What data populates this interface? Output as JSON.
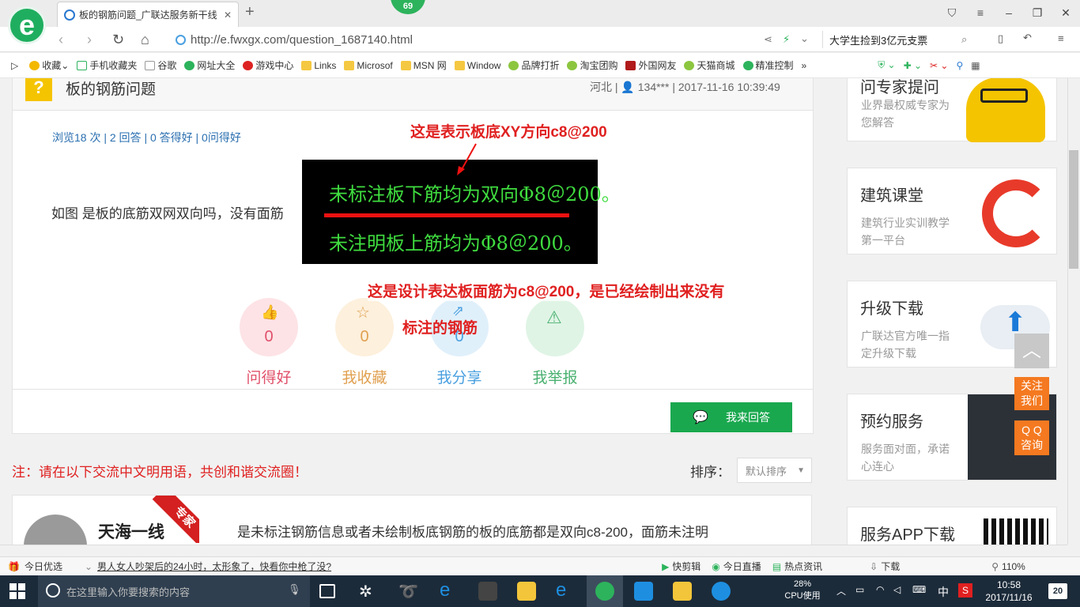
{
  "browser": {
    "tab_title": "板的钢筋问题_广联达服务新干线",
    "tab_close": "✕",
    "new_tab": "+",
    "badge": "69",
    "url": "http://e.fwxgx.com/question_1687140.html",
    "search_text": "大学生捡到3亿元支票",
    "bookmarks": [
      "收藏",
      "手机收藏夹",
      "谷歌",
      "网址大全",
      "游戏中心",
      "Links",
      "Microsof",
      "MSN 网",
      "Window",
      "品牌打折",
      "淘宝团购",
      "外国网友",
      "天猫商城",
      "精准控制"
    ]
  },
  "question": {
    "title": "板的钢筋问题",
    "location": "河北",
    "user": "134***",
    "time": "2017-11-16 10:39:49",
    "stats": "浏览18 次 | 2 回答 | 0 答得好 | 0问得好",
    "body": "如图  是板的底筋双网双向吗，没有面筋",
    "annotation1": "这是表示板底XY方向c8@200",
    "annotation2_line1": "这是设计表达板面筋为c8@200，是已经绘制出来没有",
    "annotation2_line2": "标注的钢筋",
    "cad_line1": "未标注板下筋均为双向Φ8＠200。",
    "cad_line2": "未注明板上筋均为Φ8＠200。"
  },
  "actions": [
    {
      "count": "0",
      "label": "问得好",
      "color": "#e0506a"
    },
    {
      "count": "0",
      "label": "我收藏",
      "color": "#e0a050"
    },
    {
      "count": "0",
      "label": "我分享",
      "color": "#4aa0e0"
    },
    {
      "count": "",
      "label": "我举报",
      "color": "#4ab070"
    }
  ],
  "answer_button": "我来回答",
  "notice": "注：请在以下交流中文明用语，共创和谐交流圈！",
  "sort_label": "排序：",
  "sort_value": "默认排序",
  "answer": {
    "author": "天海一线",
    "tag": "专家",
    "text": "是未标注钢筋信息或者未绘制板底钢筋的板的底筋都是双向c8-200，面筋未注明"
  },
  "sidebar": [
    {
      "title": "问专家提问",
      "sub": "业界最权威专家为您解答"
    },
    {
      "title": "建筑课堂",
      "sub": "建筑行业实训教学第一平台"
    },
    {
      "title": "升级下载",
      "sub": "广联达官方唯一指定升级下载"
    },
    {
      "title": "预约服务",
      "sub": "服务面对面，承诺心连心"
    },
    {
      "title": "服务APP下载",
      "sub": ""
    }
  ],
  "float_buttons": {
    "follow": "关注\n我们",
    "qq": "Q Q\n咨询"
  },
  "statusbar": {
    "left1": "今日优选",
    "news": "男人女人吵架后的24小时，太形象了，快看你中枪了没?",
    "items": [
      "快剪辑",
      "今日直播",
      "热点资讯",
      "下载"
    ],
    "zoom": "110%"
  },
  "taskbar": {
    "search_placeholder": "在这里输入你要搜索的内容",
    "cpu": "28%",
    "cpu_label": "CPU使用",
    "ime": "中",
    "time": "10:58",
    "date": "2017/11/16",
    "notif": "20"
  }
}
